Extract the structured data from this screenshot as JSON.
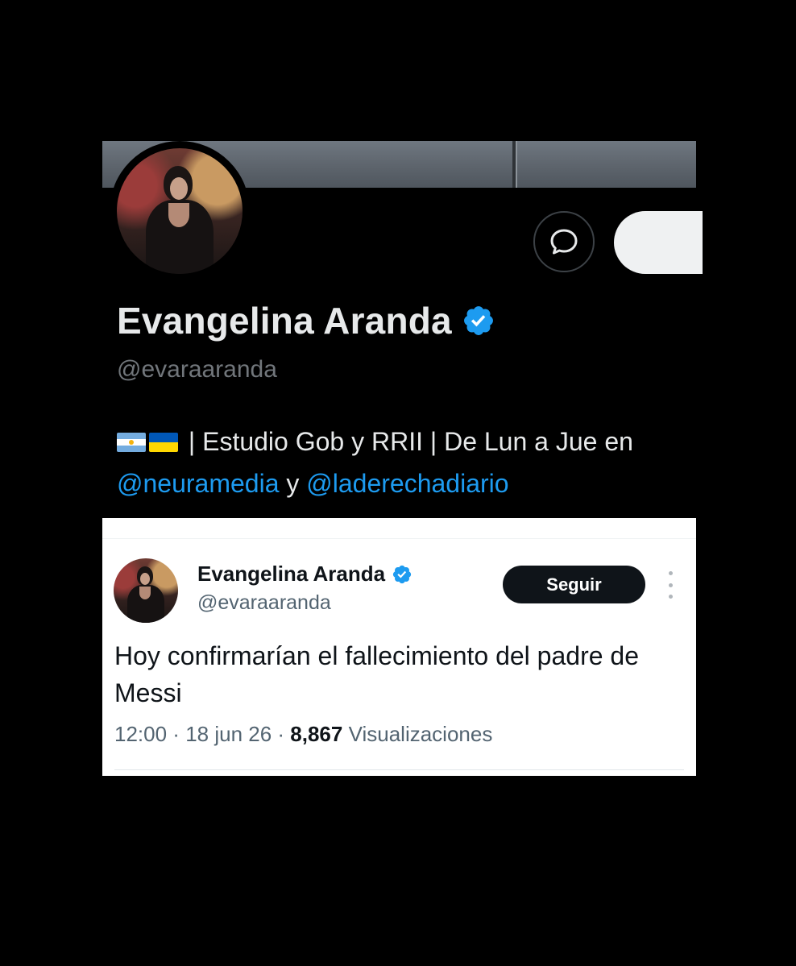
{
  "profile": {
    "display_name": "Evangelina Aranda",
    "handle": "@evaraaranda",
    "verified": true,
    "bio": {
      "flags": [
        "argentina-flag",
        "ukraine-flag"
      ],
      "text": " | Estudio Gob y RRII | De Lun a Jue en ",
      "mention_1": "@neuramedia",
      "connector": " y ",
      "mention_2": "@laderechadiario"
    }
  },
  "tweet": {
    "display_name": "Evangelina Aranda",
    "handle": "@evaraaranda",
    "verified": true,
    "follow_label": "Seguir",
    "text": "Hoy confirmarían el fallecimiento del padre de Messi",
    "time": "12:00",
    "separator": " · ",
    "date": "18 jun 26",
    "views_count": "8,867",
    "views_label": "Visualizaciones"
  },
  "colors": {
    "accent": "#1d9bf0",
    "verified": "#1d9bf0",
    "dark_bg": "#000000",
    "light_bg": "#ffffff"
  }
}
